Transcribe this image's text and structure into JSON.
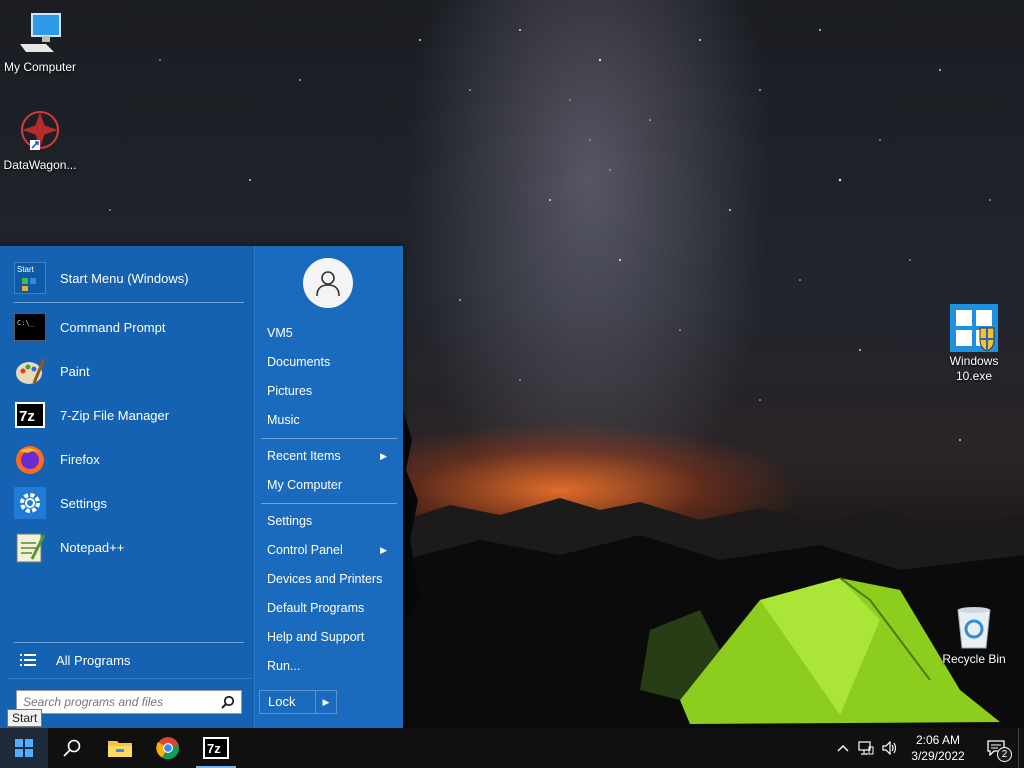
{
  "desktop": {
    "icons": [
      {
        "label": "My Computer"
      },
      {
        "label": "DataWagon..."
      },
      {
        "label": "Windows 10.exe"
      },
      {
        "label": "Recycle Bin"
      }
    ]
  },
  "start_menu": {
    "title_item": "Start Menu (Windows)",
    "pinned": [
      {
        "label": "Command Prompt",
        "icon": "command-prompt-icon"
      },
      {
        "label": "Paint",
        "icon": "paint-icon"
      },
      {
        "label": "7-Zip File Manager",
        "icon": "7zip-icon"
      },
      {
        "label": "Firefox",
        "icon": "firefox-icon"
      },
      {
        "label": "Settings",
        "icon": "gear-icon"
      },
      {
        "label": "Notepad++",
        "icon": "notepadpp-icon"
      }
    ],
    "all_programs": "All Programs",
    "search_placeholder": "Search programs and files",
    "right": {
      "user": "VM5",
      "documents": "Documents",
      "pictures": "Pictures",
      "music": "Music",
      "recent_items": "Recent Items",
      "my_computer": "My Computer",
      "settings": "Settings",
      "control_panel": "Control Panel",
      "devices_printers": "Devices and Printers",
      "default_programs": "Default Programs",
      "help_support": "Help and Support",
      "run": "Run...",
      "lock": "Lock"
    },
    "tooltip": "Start"
  },
  "taskbar": {
    "clock_time": "2:06 AM",
    "clock_date": "3/29/2022",
    "notification_count": "2",
    "accent": "#77b4ea"
  }
}
